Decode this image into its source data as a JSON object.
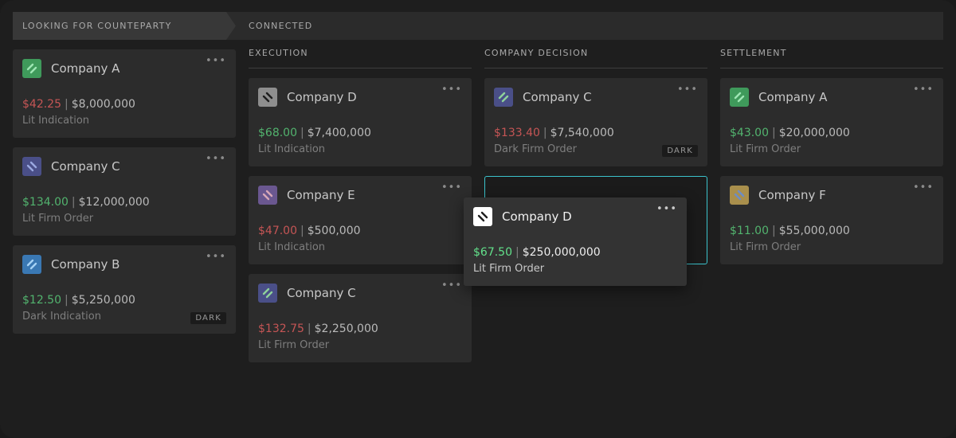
{
  "stages": {
    "looking": "LOOKING FOR COUNTEPARTY",
    "connected": "CONNECTED"
  },
  "columns": {
    "execution": "EXECUTION",
    "decision": "COMPANY DECISION",
    "settlement": "SETTLEMENT"
  },
  "more_glyph": "•••",
  "colors": {
    "price_up": "#52b36e",
    "price_down": "#c55555",
    "drop_highlight": "#3bc3cc",
    "logo_green": "#3f9a5b",
    "logo_indigo": "#4a4f88",
    "logo_blue": "#3a78b3",
    "logo_gray": "#8e8e8e",
    "logo_purple": "#6a5790",
    "logo_gold": "#a98f4c",
    "logo_white": "#ffffff"
  },
  "cards": {
    "looking": [
      {
        "name": "Company A",
        "price": "$42.25",
        "amount": "$8,000,000",
        "type": "Lit Indication"
      },
      {
        "name": "Company C",
        "price": "$134.00",
        "amount": "$12,000,000",
        "type": "Lit Firm Order"
      },
      {
        "name": "Company B",
        "price": "$12.50",
        "amount": "$5,250,000",
        "type": "Dark Indication",
        "badge": "DARK"
      }
    ],
    "execution": [
      {
        "name": "Company D",
        "price": "$68.00",
        "amount": "$7,400,000",
        "type": "Lit Indication"
      },
      {
        "name": "Company E",
        "price": "$47.00",
        "amount": "$500,000",
        "type": "Lit Indication"
      },
      {
        "name": "Company C",
        "price": "$132.75",
        "amount": "$2,250,000",
        "type": "Lit Firm Order"
      }
    ],
    "decision": [
      {
        "name": "Company C",
        "price": "$133.40",
        "amount": "$7,540,000",
        "type": "Dark Firm Order",
        "badge": "DARK"
      }
    ],
    "settlement": [
      {
        "name": "Company A",
        "price": "$43.00",
        "amount": "$20,000,000",
        "type": "Lit Firm Order"
      },
      {
        "name": "Company F",
        "price": "$11.00",
        "amount": "$55,000,000",
        "type": "Lit Firm Order"
      }
    ],
    "dragging": {
      "name": "Company D",
      "price": "$67.50",
      "amount": "$250,000,000",
      "type": "Lit Firm Order"
    }
  }
}
